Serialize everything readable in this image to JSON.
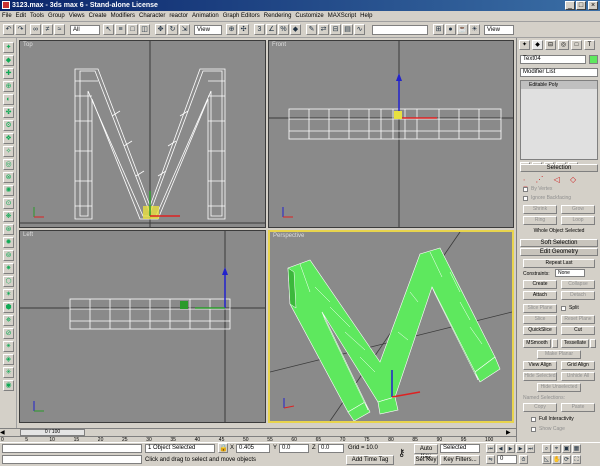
{
  "window": {
    "title": "3123.max - 3ds max 6 - Stand-alone License"
  },
  "menu": [
    "File",
    "Edit",
    "Tools",
    "Group",
    "Views",
    "Create",
    "Modifiers",
    "Character",
    "reactor",
    "Animation",
    "Graph Editors",
    "Rendering",
    "Customize",
    "MAXScript",
    "Help"
  ],
  "toolbar": {
    "selection_filter": "All",
    "ref_coord": "View",
    "named_selection": "",
    "panel_view": "View"
  },
  "viewports": {
    "top": "Top",
    "front": "Front",
    "left": "Left",
    "perspective": "Perspective"
  },
  "panel": {
    "object_name": "Text04",
    "modifier_list": "Modifier List",
    "stack_item": "Editable Poly",
    "rollouts": {
      "selection": "Selection",
      "soft_selection": "Soft Selection",
      "edit_geometry": "Edit Geometry"
    },
    "selection": {
      "by_vertex": "By Vertex",
      "ignore_backfacing": "Ignore Backfacing",
      "shrink": "Shrink",
      "grow": "Grow",
      "ring": "Ring",
      "loop": "Loop",
      "status": "Whole Object Selected"
    },
    "edit_geometry": {
      "repeat_last": "Repeat Last",
      "constraints_label": "Constraints:",
      "constraints_value": "None",
      "create": "Create",
      "collapse": "Collapse",
      "attach": "Attach",
      "detach": "Detach",
      "slice_plane": "Slice Plane",
      "split": "Split",
      "slice": "Slice",
      "reset_plane": "Reset Plane",
      "quickslice": "QuickSlice",
      "cut": "Cut",
      "msmooth": "MSmooth",
      "tessellate": "Tessellate",
      "make_planar": "Make Planar",
      "view_align": "View Align",
      "grid_align": "Grid Align",
      "hide_selected": "Hide Selected",
      "unhide_all": "Unhide All",
      "hide_unselected": "Hide Unselected",
      "named_selections": "Named Selections:",
      "copy": "Copy",
      "paste": "Paste",
      "full_interactivity": "Full Interactivity",
      "show_cage": "Show Cage"
    }
  },
  "timeline": {
    "frame_counter": "0 / 100",
    "ticks": [
      "0",
      "5",
      "10",
      "15",
      "20",
      "25",
      "30",
      "35",
      "40",
      "45",
      "50",
      "55",
      "60",
      "65",
      "70",
      "75",
      "80",
      "85",
      "90",
      "95",
      "100"
    ]
  },
  "status": {
    "objects_selected": "1 Object Selected",
    "prompt": "Click and drag to select and move objects",
    "x_label": "X",
    "x_value": "0.405",
    "y_label": "Y",
    "y_value": "0.0",
    "z_label": "Z",
    "z_value": "0.0",
    "grid": "Grid = 10.0",
    "add_time_tag": "Add Time Tag",
    "auto_key": "Auto Key",
    "selected_dropdown": "Selected",
    "set_key": "Set Key",
    "key_filters": "Key Filters...",
    "frame": "0"
  },
  "colors": {
    "viewport_bg": "#8a8a8a",
    "wire": "#ffffff",
    "active_border": "#e8d44d",
    "mesh_green": "#5ee85e"
  }
}
